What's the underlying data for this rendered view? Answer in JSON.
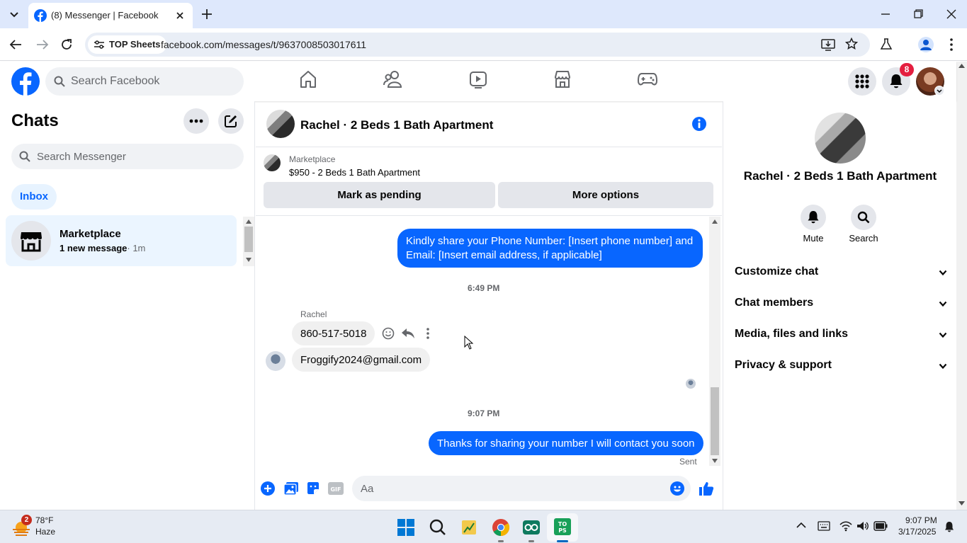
{
  "browser": {
    "tab_title": "(8) Messenger | Facebook",
    "chip_label": "TOP Sheets",
    "url": "facebook.com/messages/t/9637008503017611"
  },
  "fb_header": {
    "search_placeholder": "Search Facebook",
    "notification_count": "8"
  },
  "sidebar": {
    "title": "Chats",
    "search_placeholder": "Search Messenger",
    "filter_label": "Inbox",
    "chats": [
      {
        "name": "Marketplace",
        "preview": "1 new message",
        "time": "· 1m"
      }
    ]
  },
  "conversation": {
    "title": "Rachel · 2 Beds 1 Bath Apartment",
    "marketplace_label": "Marketplace",
    "listing": "$950 - 2 Beds 1 Bath Apartment",
    "buttons": {
      "mark_pending": "Mark as pending",
      "more_options": "More options"
    },
    "messages": {
      "msg1": "Kindly share your Phone Number: [Insert phone number] and Email: [Insert email address, if applicable]",
      "time1": "6:49 PM",
      "sender": "Rachel",
      "msg2": "860-517-5018",
      "msg3": "Froggify2024@gmail.com",
      "time2": "9:07 PM",
      "msg4": "Thanks for sharing your number I will contact you soon",
      "status": "Sent"
    },
    "composer_placeholder": "Aa"
  },
  "details": {
    "title": "Rachel · 2 Beds 1 Bath Apartment",
    "mute_label": "Mute",
    "search_label": "Search",
    "sections": [
      "Customize chat",
      "Chat members",
      "Media, files and links",
      "Privacy & support"
    ]
  },
  "taskbar": {
    "weather_temp": "78°F",
    "weather_desc": "Haze",
    "weather_badge": "2",
    "time": "9:07 PM",
    "date": "3/17/2025"
  },
  "colors": {
    "fb_blue": "#0866ff",
    "badge_red": "#e41e3f",
    "chrome_bg": "#dee8fc"
  }
}
